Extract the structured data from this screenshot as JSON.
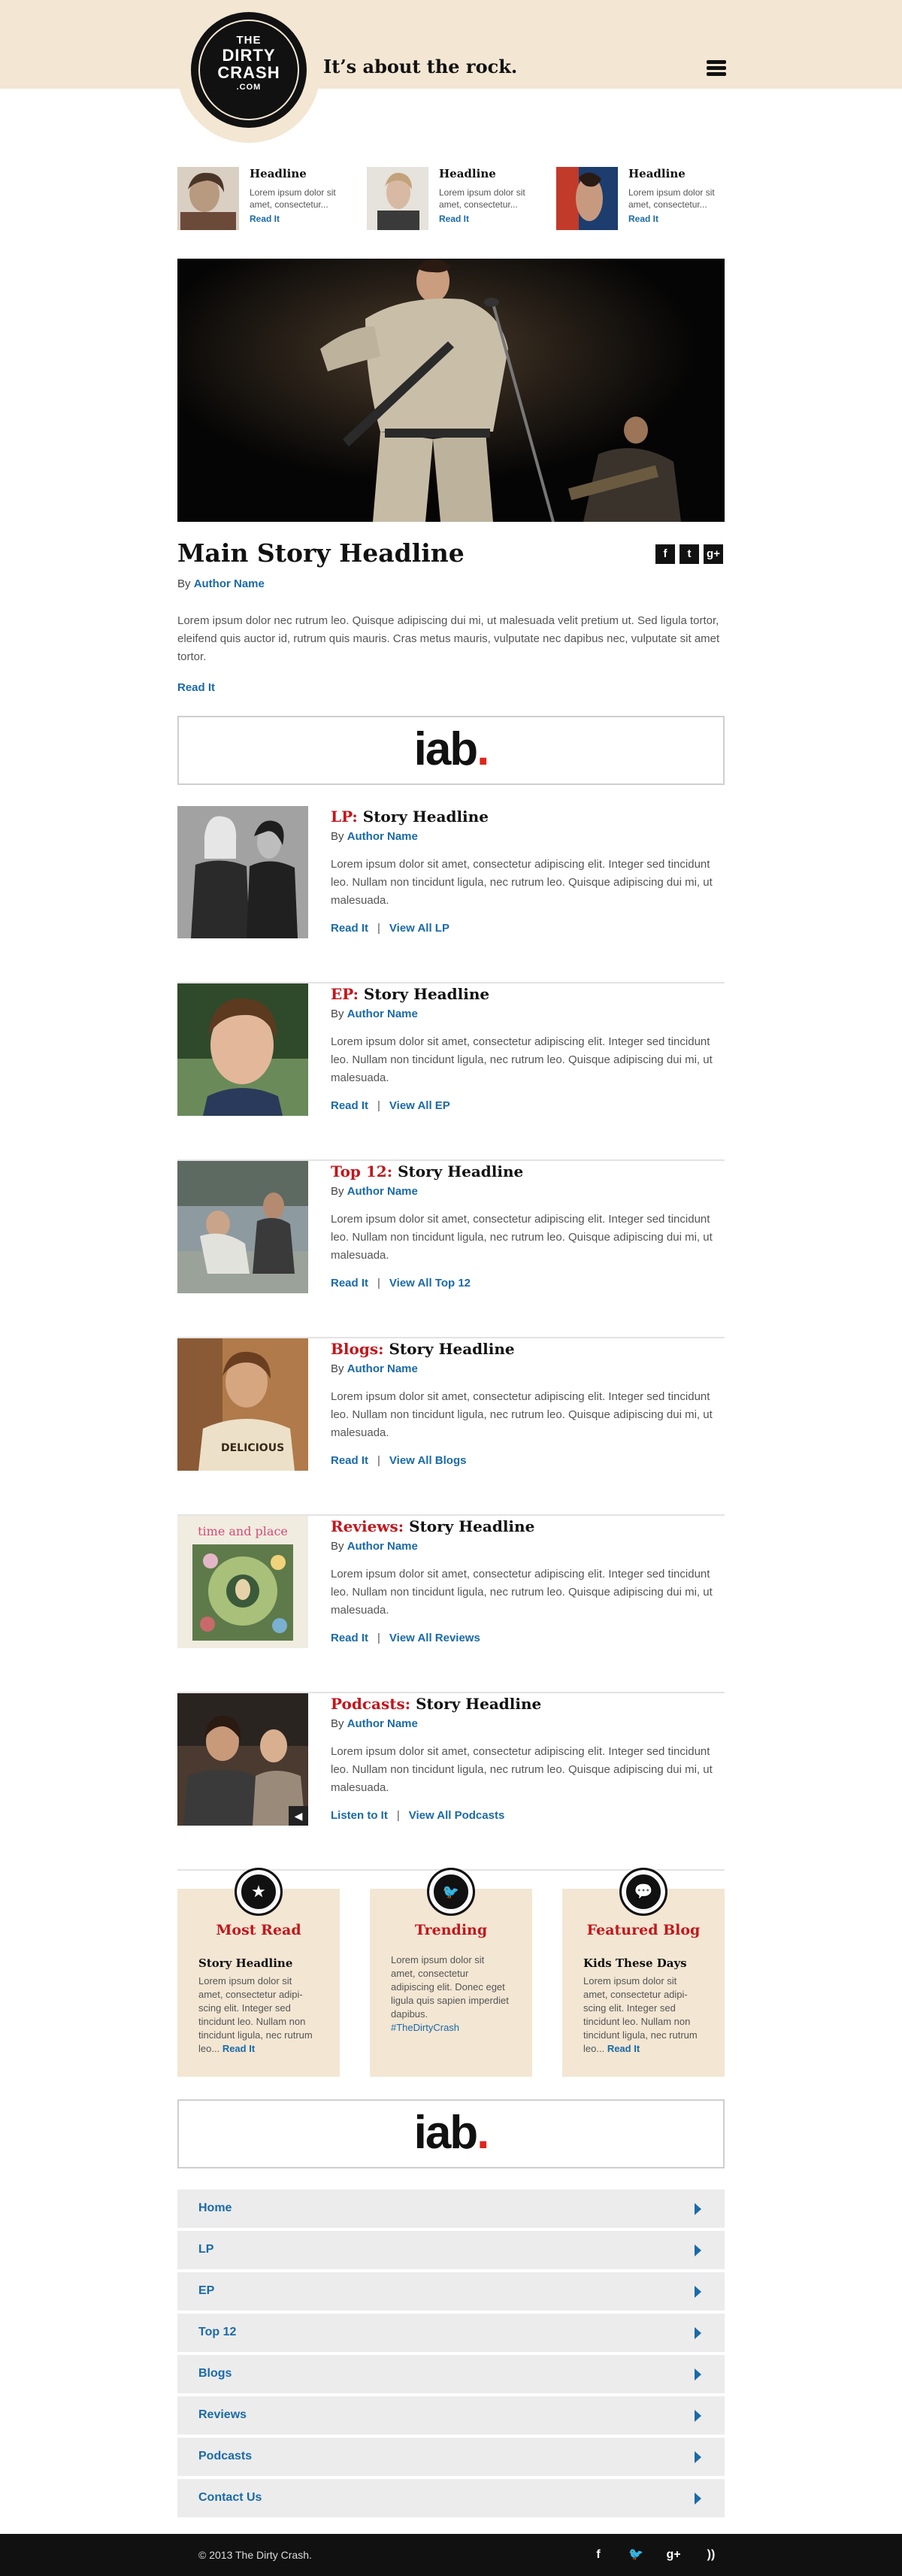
{
  "header": {
    "logo_line1": "THE",
    "logo_line2": "DIRTY",
    "logo_line3": "CRASH",
    "logo_line4": ".COM",
    "tagline": "It’s about the rock."
  },
  "top_stories": [
    {
      "headline": "Headline",
      "text": "Lorem ipsum dolor sit amet, consectetur...",
      "link": "Read It"
    },
    {
      "headline": "Headline",
      "text": "Lorem ipsum dolor sit amet, consectetur...",
      "link": "Read It"
    },
    {
      "headline": "Headline",
      "text": "Lorem ipsum dolor sit amet, consectetur...",
      "link": "Read It"
    }
  ],
  "main_story": {
    "title": "Main Story Headline",
    "by_prefix": "By",
    "author": "Author Name",
    "body": "Lorem ipsum dolor nec rutrum leo. Quisque adipiscing dui mi, ut malesuada velit pretium ut. Sed ligula tortor, eleifend quis auctor id, rutrum quis mauris. Cras metus mauris, vulputate nec dapibus nec, vulputate sit amet tortor.",
    "link": "Read It",
    "social": [
      "f",
      "t",
      "g+"
    ]
  },
  "ad": {
    "logo_text_i": "i",
    "logo_text_ab": "ab",
    "logo_dot": "."
  },
  "stories": [
    {
      "category": "LP:",
      "headline": "Story Headline",
      "by_prefix": "By",
      "author": "Author Name",
      "text": "Lorem ipsum dolor sit amet, consectetur adipiscing elit. Integer sed tincidunt leo. Nullam non tincidunt ligula, nec rutrum leo. Quisque adipiscing dui mi, ut malesuada.",
      "link1": "Read It",
      "link2": "View All LP"
    },
    {
      "category": "EP:",
      "headline": "Story Headline",
      "by_prefix": "By",
      "author": "Author Name",
      "text": "Lorem ipsum dolor sit amet, consectetur adipiscing elit. Integer sed tincidunt leo. Nullam non tincidunt ligula, nec rutrum leo. Quisque adipiscing dui mi, ut malesuada.",
      "link1": "Read It",
      "link2": "View All EP"
    },
    {
      "category": "Top 12:",
      "headline": "Story Headline",
      "by_prefix": "By",
      "author": "Author Name",
      "text": "Lorem ipsum dolor sit amet, consectetur adipiscing elit. Integer sed tincidunt leo. Nullam non tincidunt ligula, nec rutrum leo. Quisque adipiscing dui mi, ut malesuada.",
      "link1": "Read It",
      "link2": "View All Top 12"
    },
    {
      "category": "Blogs:",
      "headline": "Story Headline",
      "by_prefix": "By",
      "author": "Author Name",
      "text": "Lorem ipsum dolor sit amet, consectetur adipiscing elit. Integer sed tincidunt leo. Nullam non tincidunt ligula, nec rutrum leo. Quisque adipiscing dui mi, ut malesuada.",
      "link1": "Read It",
      "link2": "View All Blogs"
    },
    {
      "category": "Reviews:",
      "headline": "Story Headline",
      "by_prefix": "By",
      "author": "Author Name",
      "text": "Lorem ipsum dolor sit amet, consectetur adipiscing elit. Integer sed tincidunt leo. Nullam non tincidunt ligula, nec rutrum leo. Quisque adipiscing dui mi, ut malesuada.",
      "link1": "Read It",
      "link2": "View All Reviews",
      "album_text": "time and place"
    },
    {
      "category": "Podcasts:",
      "headline": "Story Headline",
      "by_prefix": "By",
      "author": "Author Name",
      "text": "Lorem ipsum dolor sit amet, consectetur adipiscing elit. Integer sed tincidunt leo. Nullam non tincidunt ligula, nec rutrum leo. Quisque adipiscing dui mi, ut malesuada.",
      "link1": "Listen to It",
      "link2": "View All Podcasts"
    }
  ],
  "boxes": [
    {
      "title": "Most Read",
      "icon": "star-icon",
      "headline": "Story Headline",
      "text": "Lorem ipsum dolor sit amet, consectetur adipi-scing elit. Integer sed tincidunt leo. Nullam non tincidunt ligula, nec rutrum leo...",
      "link": "Read It"
    },
    {
      "title": "Trending",
      "icon": "twitter-bird-icon",
      "headline": "",
      "text": "Lorem ipsum dolor sit amet, consectetur adipiscing elit. Donec eget ligula quis sapien imperdiet dapibus.",
      "link": "#TheDirtyCrash"
    },
    {
      "title": "Featured Blog",
      "icon": "speech-bubble-icon",
      "headline": "Kids These Days",
      "text": "Lorem ipsum dolor sit amet, consectetur adipi-scing elit. Integer sed tincidunt leo. Nullam non tincidunt ligula, nec rutrum leo...",
      "link": "Read It"
    }
  ],
  "nav": [
    "Home",
    "LP",
    "EP",
    "Top 12",
    "Blogs",
    "Reviews",
    "Podcasts",
    "Contact Us"
  ],
  "footer": {
    "copyright": "© 2013 The Dirty Crash.",
    "social": [
      "f",
      "t",
      "g+",
      "rss"
    ]
  },
  "colors": {
    "beige": "#f3e6d3",
    "red": "#c3161c",
    "blue": "#1a6aa8",
    "ad_red": "#e0261b"
  }
}
